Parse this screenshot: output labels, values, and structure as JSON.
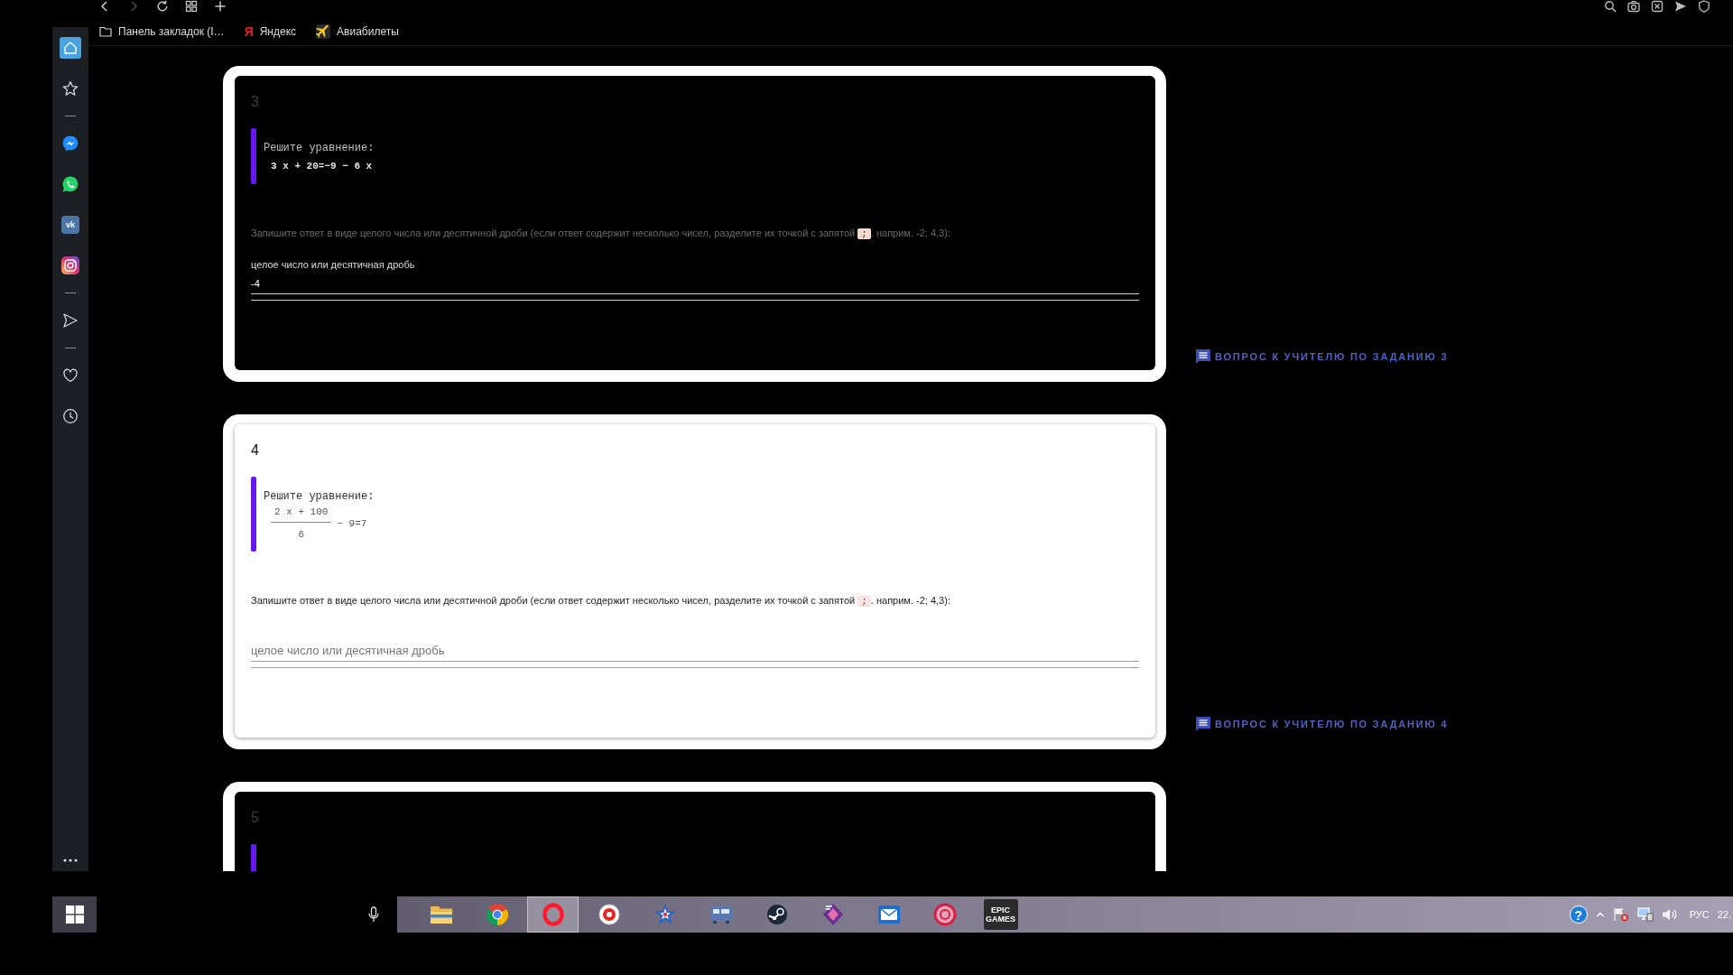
{
  "toolbar": {
    "nav": [
      {
        "kind": "back",
        "disabled": false
      },
      {
        "kind": "forward",
        "disabled": true
      },
      {
        "kind": "reload",
        "disabled": false
      },
      {
        "kind": "tabs",
        "disabled": false
      },
      {
        "kind": "new-tab",
        "disabled": false
      }
    ],
    "tools": [
      {
        "kind": "search"
      },
      {
        "kind": "camera"
      },
      {
        "kind": "box"
      },
      {
        "kind": "send"
      },
      {
        "kind": "shield"
      }
    ]
  },
  "bookmarks": [
    {
      "kind": "folder",
      "label": "Панель закладок (I…"
    },
    {
      "kind": "yandex",
      "glyph": "Я",
      "label": "Яндекс"
    },
    {
      "kind": "plane",
      "label": "Авиабилеты"
    }
  ],
  "sidebar": {
    "groups": [
      [
        {
          "kind": "home",
          "selected": true
        },
        {
          "kind": "star",
          "selected": false
        }
      ],
      [
        {
          "kind": "messenger",
          "selected": false
        },
        {
          "kind": "whatsapp",
          "selected": false
        },
        {
          "kind": "vk",
          "glyph": "vk",
          "selected": false
        },
        {
          "kind": "instagram",
          "selected": false
        }
      ],
      [
        {
          "kind": "send",
          "selected": false
        }
      ],
      [
        {
          "kind": "heart",
          "selected": false
        },
        {
          "kind": "clock",
          "selected": false
        }
      ]
    ],
    "more_button": true
  },
  "tasks": [
    {
      "number": "3",
      "dark": true,
      "prompt": "Решите уравнение:",
      "equation": {
        "kind": "inline",
        "text": "3 x + 20=−9 − 6 x"
      },
      "instruction": "Запишите ответ в виде целого числа или десятичной дроби (если ответ содержит несколько чисел, разделите их точкой с запятой ",
      "code": ";",
      "instruction_end": ". наприм. -2; 4,3):",
      "field": {
        "label": "целое число или десятичная дробь",
        "value": "-4"
      },
      "question_link": "ВОПРОС К УЧИТЕЛЮ ПО ЗАДАНИЮ 3"
    },
    {
      "number": "4",
      "dark": false,
      "prompt": "Решите уравнение:",
      "equation": {
        "kind": "fraction",
        "numerator": "2 x + 100",
        "denominator": "6",
        "rest": "− 9=7"
      },
      "instruction": "Запишите ответ в виде целого числа или десятичной дроби (если ответ содержит несколько чисел, разделите их точкой с запятой ",
      "code": ";",
      "instruction_end": ". наприм. -2; 4,3):",
      "field": {
        "placeholder": "целое число или десятичная дробь"
      },
      "question_link": "ВОПРОС К УЧИТЕЛЮ ПО ЗАДАНИЮ 4"
    },
    {
      "number": "5",
      "dark": true
    }
  ],
  "taskbar": {
    "apps": [
      {
        "kind": "folder",
        "active": false
      },
      {
        "kind": "tricolor",
        "active": false
      },
      {
        "kind": "red-ring",
        "active": true
      },
      {
        "kind": "red-disc",
        "active": false
      },
      {
        "kind": "star",
        "active": false
      },
      {
        "kind": "panel",
        "active": false
      },
      {
        "kind": "dark-disc",
        "active": false
      },
      {
        "kind": "diamond",
        "active": false
      },
      {
        "kind": "mail",
        "active": false
      },
      {
        "kind": "pink-ring",
        "active": false
      },
      {
        "kind": "tile",
        "label": "EPIC GAMES",
        "active": false
      }
    ],
    "tray": {
      "help": "?",
      "icons": [
        {
          "kind": "caret"
        },
        {
          "kind": "flag"
        },
        {
          "kind": "network"
        },
        {
          "kind": "volume"
        }
      ],
      "language": "РУС",
      "clock": "22."
    }
  }
}
